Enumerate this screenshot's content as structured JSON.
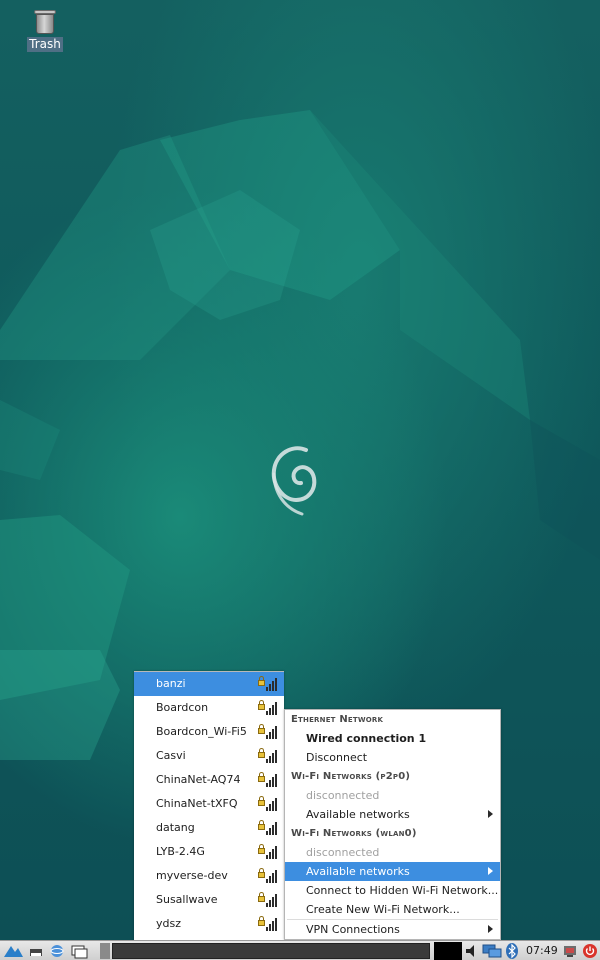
{
  "desktop": {
    "trash_label": "Trash"
  },
  "wifi_list": {
    "items": [
      {
        "ssid": "banzi",
        "selected": true
      },
      {
        "ssid": "Boardcon",
        "selected": false
      },
      {
        "ssid": "Boardcon_Wi-Fi5",
        "selected": false
      },
      {
        "ssid": "Casvi",
        "selected": false
      },
      {
        "ssid": "ChinaNet-AQ74",
        "selected": false
      },
      {
        "ssid": "ChinaNet-tXFQ",
        "selected": false
      },
      {
        "ssid": "datang",
        "selected": false
      },
      {
        "ssid": "LYB-2.4G",
        "selected": false
      },
      {
        "ssid": "myverse-dev",
        "selected": false
      },
      {
        "ssid": "Susallwave",
        "selected": false
      },
      {
        "ssid": "ydsz",
        "selected": false
      }
    ]
  },
  "network_menu": {
    "ethernet_header": "Ethernet Network",
    "wired_connection": "Wired connection 1",
    "disconnect": "Disconnect",
    "wifi_p2p_header": "Wi-Fi Networks (p2p0)",
    "p2p_status": "disconnected",
    "p2p_available": "Available networks",
    "wifi_wlan_header": "Wi-Fi Networks (wlan0)",
    "wlan_status": "disconnected",
    "wlan_available": "Available networks",
    "connect_hidden": "Connect to Hidden Wi-Fi Network...",
    "create_new": "Create New Wi-Fi Network...",
    "vpn": "VPN Connections"
  },
  "taskbar": {
    "clock": "07:49"
  },
  "colors": {
    "selection": "#3d8ee0",
    "desktop_bg": "#0f5a5a"
  }
}
